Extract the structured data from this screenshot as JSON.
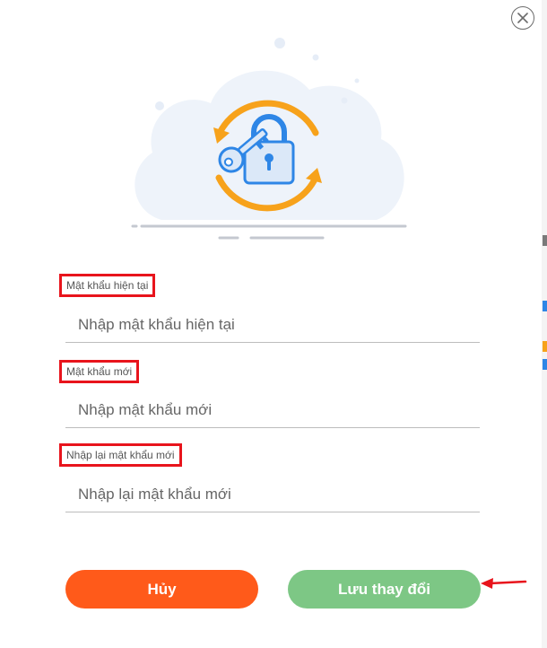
{
  "dialog": {
    "close_label": "×"
  },
  "form": {
    "current_password": {
      "label": "Mật khẩu hiện tại",
      "placeholder": "Nhập mật khẩu hiện tại",
      "value": ""
    },
    "new_password": {
      "label": "Mật khẩu mới",
      "placeholder": "Nhập mật khẩu mới",
      "value": ""
    },
    "confirm_password": {
      "label": "Nhập lại mật khẩu mới",
      "placeholder": "Nhập lại mật khẩu mới",
      "value": ""
    }
  },
  "actions": {
    "cancel_label": "Hủy",
    "save_label": "Lưu thay đổi"
  },
  "icons": {
    "close": "close-icon",
    "illustration": "password-reset-illustration",
    "arrow": "annotation-arrow"
  },
  "colors": {
    "cancel_button": "#ff5a1a",
    "save_button": "#7dc785",
    "highlight_box": "#e8141c",
    "illustration_orange": "#f7a21b",
    "illustration_blue": "#2e86e6"
  }
}
